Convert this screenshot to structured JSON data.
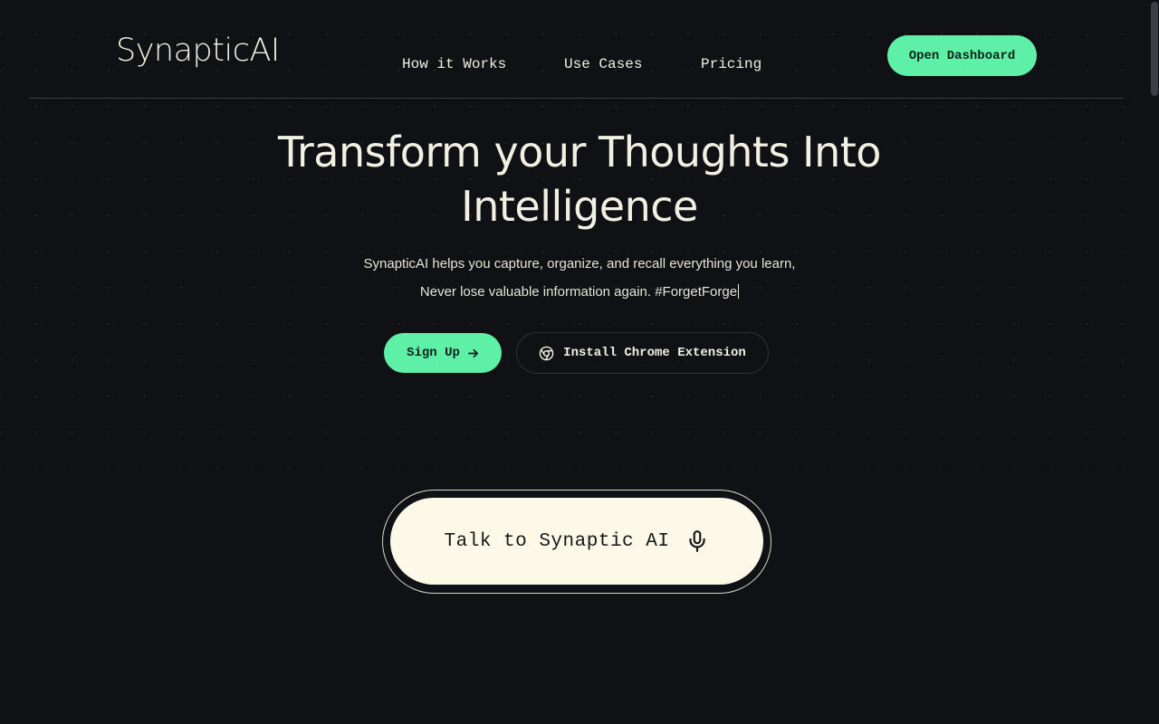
{
  "header": {
    "logo": "SynapticAI",
    "nav": [
      {
        "label": "How it Works"
      },
      {
        "label": "Use Cases"
      },
      {
        "label": "Pricing"
      }
    ],
    "cta_label": "Open Dashboard"
  },
  "hero": {
    "title_line1": "Transform your Thoughts Into",
    "title_line2": "Intelligence",
    "subtitle_line1": "SynapticAI helps you capture, organize, and recall everything you learn,",
    "subtitle_line2": "Never lose valuable information again. #ForgetForge",
    "signup_label": "Sign Up",
    "signup_icon": "arrow-right-icon",
    "chrome_label": "Install Chrome Extension",
    "chrome_icon": "chrome-icon"
  },
  "voice": {
    "label": "Talk to Synaptic AI",
    "icon": "microphone-icon"
  },
  "colors": {
    "background": "#0f1114",
    "accent": "#5ef0a6",
    "text": "#f3efe2",
    "talk_button_bg": "#fdf9e8"
  }
}
